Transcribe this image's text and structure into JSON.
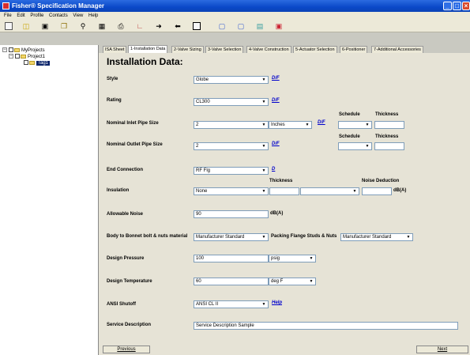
{
  "window": {
    "title": "Fisher® Specification Manager"
  },
  "menu": [
    "File",
    "Edit",
    "Profile",
    "Contacts",
    "View",
    "Help"
  ],
  "toolbar_icons": [
    "new-icon",
    "open-icon",
    "save-icon",
    "copy-icon",
    "zoom-icon",
    "grid-icon",
    "print-icon",
    "chart-icon",
    "arrow-right-icon",
    "arrow-left-icon",
    "window-icon",
    "f-icon",
    "in-icon",
    "doc-icon",
    "save-red-icon"
  ],
  "tree": {
    "root": "MyProjects",
    "project": "Project1",
    "tag": "Tag1"
  },
  "tabs": [
    "ISA Sheet",
    "1-Installation Data",
    "2-Valve Sizing",
    "3-Valve Selection",
    "4-Valve Construction",
    "5-Actuator Selection",
    "6-Positioner",
    "7-Additional Accessories"
  ],
  "form": {
    "heading": "Installation Data:",
    "style": {
      "label": "Style",
      "value": "Globe",
      "link": "D/F"
    },
    "rating": {
      "label": "Rating",
      "value": "CL300",
      "link": "D/F"
    },
    "inlet": {
      "label": "Nominal Inlet Pipe Size",
      "value": "2",
      "unit": "Inches",
      "link": "D/F",
      "schedule_label": "Schedule",
      "thickness_label": "Thickness",
      "schedule": "",
      "thickness": ""
    },
    "outlet": {
      "label": "Nominal Outlet Pipe Size",
      "value": "2",
      "link": "D/F",
      "schedule_label": "Schedule",
      "thickness_label": "Thickness",
      "schedule": "",
      "thickness": ""
    },
    "end_connection": {
      "label": "End Connection",
      "value": "RF Flg",
      "link": "D"
    },
    "insulation": {
      "label": "Insulation",
      "value": "None",
      "thickness_label": "Thickness",
      "thickness": "",
      "thickness_unit": "",
      "noise_label": "Noise Deduction",
      "noise": "",
      "noise_unit": "dB(A)"
    },
    "noise": {
      "label": "Allowable Noise",
      "value": "90",
      "unit": "dB(A)"
    },
    "bonnet": {
      "label": "Body to Bonnet bolt & nuts material",
      "value": "Manufacturer Standard",
      "packing_label": "Packing Flange Studs & Nuts",
      "packing_value": "Manufacturer Standard"
    },
    "pressure": {
      "label": "Design Pressure",
      "value": "100",
      "unit": "psig"
    },
    "temperature": {
      "label": "Design Temperature",
      "value": "60",
      "unit": "deg F"
    },
    "shutoff": {
      "label": "ANSI Shutoff",
      "value": "ANSI CL II",
      "link": "Help"
    },
    "service": {
      "label": "Service Description",
      "value": "Service Description Sample"
    }
  },
  "buttons": {
    "previous": "Previous",
    "next": "Next"
  }
}
